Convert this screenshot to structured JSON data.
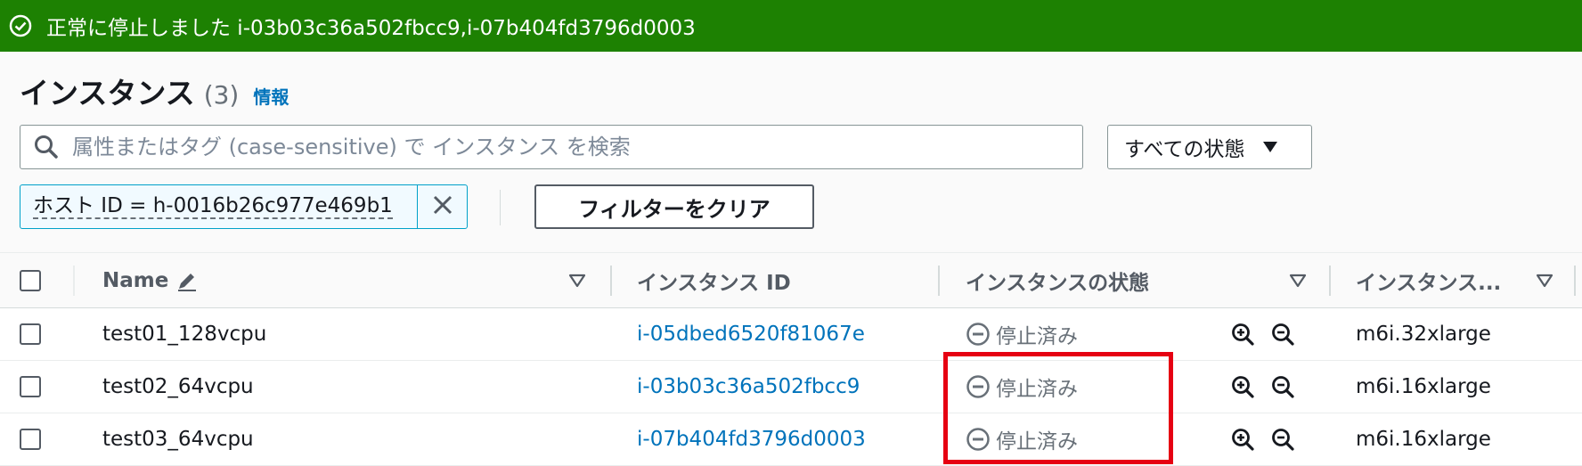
{
  "banner": {
    "message": "正常に停止しました i-03b03c36a502fbcc9,i-07b404fd3796d0003",
    "icon": "check-circle-icon",
    "color": "#1d8102"
  },
  "header": {
    "title": "インスタンス",
    "count": "(3)",
    "info_link": "情報"
  },
  "search": {
    "placeholder": "属性またはタグ (case-sensitive) で インスタンス を検索",
    "icon": "search-icon"
  },
  "state_filter": {
    "selected": "すべての状態",
    "icon": "caret-down-icon"
  },
  "filter_token": {
    "label": "ホスト ID = h-0016b26c977e469b1"
  },
  "clear_filters_label": "フィルターをクリア",
  "table": {
    "columns": [
      "Name",
      "インスタンス ID",
      "インスタンスの状態",
      "インスタンス..."
    ],
    "rows": [
      {
        "name": "test01_128vcpu",
        "instance_id": "i-05dbed6520f81067e",
        "state": "停止済み",
        "type": "m6i.32xlarge"
      },
      {
        "name": "test02_64vcpu",
        "instance_id": "i-03b03c36a502fbcc9",
        "state": "停止済み",
        "type": "m6i.16xlarge"
      },
      {
        "name": "test03_64vcpu",
        "instance_id": "i-07b404fd3796d0003",
        "state": "停止済み",
        "type": "m6i.16xlarge"
      }
    ]
  },
  "colors": {
    "link": "#0073bb",
    "highlight": "#e60012"
  }
}
